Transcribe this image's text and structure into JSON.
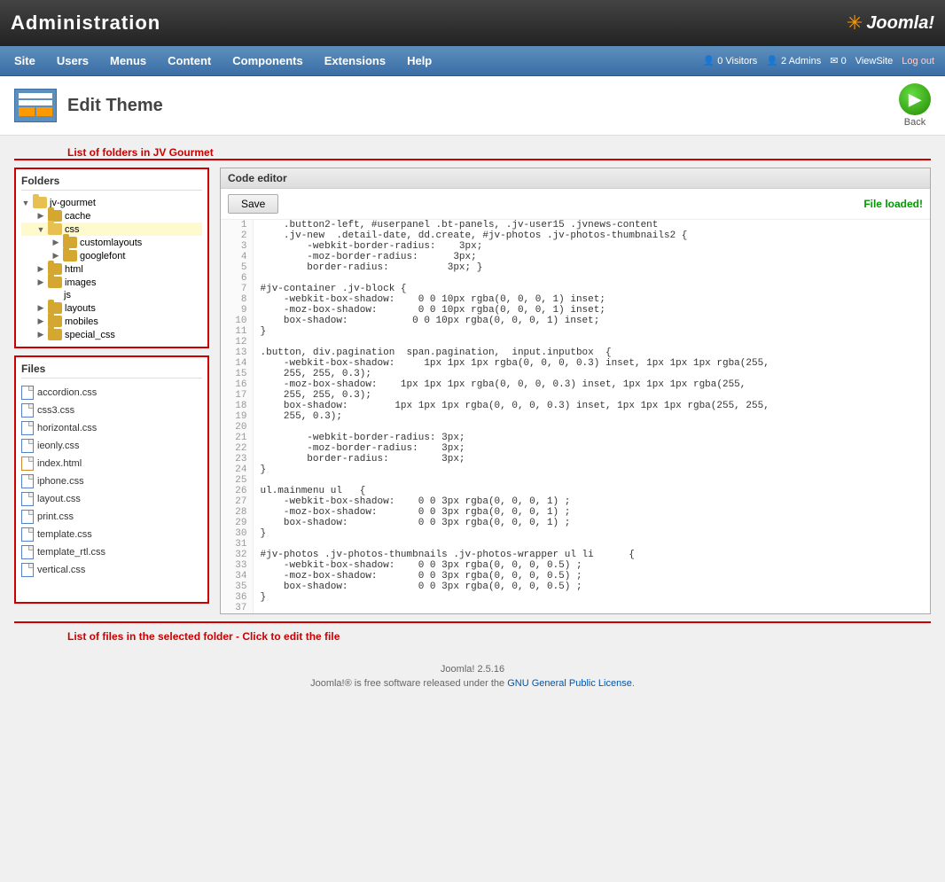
{
  "header": {
    "admin_title": "Administration",
    "joomla_logo": "Joomla!",
    "back_button_label": "Back"
  },
  "navbar": {
    "items": [
      {
        "label": "Site"
      },
      {
        "label": "Users"
      },
      {
        "label": "Menus"
      },
      {
        "label": "Content"
      },
      {
        "label": "Components"
      },
      {
        "label": "Extensions"
      },
      {
        "label": "Help"
      }
    ],
    "right": {
      "visitors": "0 Visitors",
      "admins": "2 Admins",
      "messages": "0",
      "view_site": "ViewSite",
      "log_out": "Log out"
    }
  },
  "page": {
    "title": "Edit Theme",
    "annotation_top": "List of folders in JV Gourmet",
    "annotation_bottom": "List of files in the selected folder - Click to edit the file"
  },
  "folders_panel": {
    "title": "Folders",
    "tree": [
      {
        "label": "jv-gourmet",
        "indent": 0,
        "expanded": true,
        "type": "folder"
      },
      {
        "label": "cache",
        "indent": 1,
        "expanded": false,
        "type": "folder"
      },
      {
        "label": "css",
        "indent": 1,
        "expanded": true,
        "type": "folder",
        "selected": true
      },
      {
        "label": "customlayouts",
        "indent": 2,
        "expanded": false,
        "type": "folder"
      },
      {
        "label": "googlefont",
        "indent": 2,
        "expanded": false,
        "type": "folder"
      },
      {
        "label": "html",
        "indent": 1,
        "expanded": false,
        "type": "folder"
      },
      {
        "label": "images",
        "indent": 1,
        "expanded": false,
        "type": "folder"
      },
      {
        "label": "js",
        "indent": 1,
        "expanded": false,
        "type": "folder-plain"
      },
      {
        "label": "layouts",
        "indent": 1,
        "expanded": false,
        "type": "folder"
      },
      {
        "label": "mobiles",
        "indent": 1,
        "expanded": false,
        "type": "folder"
      },
      {
        "label": "special_css",
        "indent": 1,
        "expanded": false,
        "type": "folder"
      }
    ]
  },
  "files_panel": {
    "title": "Files",
    "files": [
      {
        "label": "accordion.css",
        "type": "css"
      },
      {
        "label": "css3.css",
        "type": "css"
      },
      {
        "label": "horizontal.css",
        "type": "css"
      },
      {
        "label": "ieonly.css",
        "type": "css"
      },
      {
        "label": "index.html",
        "type": "html"
      },
      {
        "label": "iphone.css",
        "type": "css"
      },
      {
        "label": "layout.css",
        "type": "css"
      },
      {
        "label": "print.css",
        "type": "css"
      },
      {
        "label": "template.css",
        "type": "css"
      },
      {
        "label": "template_rtl.css",
        "type": "css"
      },
      {
        "label": "vertical.css",
        "type": "css"
      }
    ]
  },
  "code_editor": {
    "title": "Code editor",
    "save_label": "Save",
    "file_loaded_label": "File loaded!",
    "lines": [
      {
        "num": 1,
        "code": "    .button2-left, #userpanel .bt-panels, .jv-user15 .jvnews-content"
      },
      {
        "num": 2,
        "code": "    .jv-new  .detail-date, dd.create, #jv-photos .jv-photos-thumbnails2 {"
      },
      {
        "num": 3,
        "code": "        -webkit-border-radius:    3px;"
      },
      {
        "num": 4,
        "code": "        -moz-border-radius:      3px;"
      },
      {
        "num": 5,
        "code": "        border-radius:          3px; }"
      },
      {
        "num": 6,
        "code": ""
      },
      {
        "num": 7,
        "code": "#jv-container .jv-block {"
      },
      {
        "num": 8,
        "code": "    -webkit-box-shadow:    0 0 10px rgba(0, 0, 0, 1) inset;"
      },
      {
        "num": 9,
        "code": "    -moz-box-shadow:       0 0 10px rgba(0, 0, 0, 1) inset;"
      },
      {
        "num": 10,
        "code": "    box-shadow:           0 0 10px rgba(0, 0, 0, 1) inset;"
      },
      {
        "num": 11,
        "code": "}"
      },
      {
        "num": 12,
        "code": ""
      },
      {
        "num": 13,
        "code": ".button, div.pagination  span.pagination,  input.inputbox  {"
      },
      {
        "num": 14,
        "code": "    -webkit-box-shadow:     1px 1px 1px rgba(0, 0, 0, 0.3) inset, 1px 1px 1px rgba(255,"
      },
      {
        "num": 15,
        "code": "    255, 255, 0.3);"
      },
      {
        "num": 16,
        "code": "    -moz-box-shadow:    1px 1px 1px rgba(0, 0, 0, 0.3) inset, 1px 1px 1px rgba(255,"
      },
      {
        "num": 17,
        "code": "    255, 255, 0.3);"
      },
      {
        "num": 18,
        "code": "    box-shadow:        1px 1px 1px rgba(0, 0, 0, 0.3) inset, 1px 1px 1px rgba(255, 255,"
      },
      {
        "num": 19,
        "code": "    255, 0.3);"
      },
      {
        "num": 20,
        "code": ""
      },
      {
        "num": 21,
        "code": "        -webkit-border-radius: 3px;"
      },
      {
        "num": 22,
        "code": "        -moz-border-radius:    3px;"
      },
      {
        "num": 23,
        "code": "        border-radius:         3px;"
      },
      {
        "num": 24,
        "code": "}"
      },
      {
        "num": 25,
        "code": ""
      },
      {
        "num": 26,
        "code": "ul.mainmenu ul   {"
      },
      {
        "num": 27,
        "code": "    -webkit-box-shadow:    0 0 3px rgba(0, 0, 0, 1) ;"
      },
      {
        "num": 28,
        "code": "    -moz-box-shadow:       0 0 3px rgba(0, 0, 0, 1) ;"
      },
      {
        "num": 29,
        "code": "    box-shadow:            0 0 3px rgba(0, 0, 0, 1) ;"
      },
      {
        "num": 30,
        "code": "}"
      },
      {
        "num": 31,
        "code": ""
      },
      {
        "num": 32,
        "code": "#jv-photos .jv-photos-thumbnails .jv-photos-wrapper ul li      {"
      },
      {
        "num": 33,
        "code": "    -webkit-box-shadow:    0 0 3px rgba(0, 0, 0, 0.5) ;"
      },
      {
        "num": 34,
        "code": "    -moz-box-shadow:       0 0 3px rgba(0, 0, 0, 0.5) ;"
      },
      {
        "num": 35,
        "code": "    box-shadow:            0 0 3px rgba(0, 0, 0, 0.5) ;"
      },
      {
        "num": 36,
        "code": "}"
      },
      {
        "num": 37,
        "code": ""
      }
    ]
  },
  "footer": {
    "joomla_version": "Joomla! 2.5.16",
    "license_text": "Joomla!® is free software released under the ",
    "license_link": "GNU General Public License",
    "license_end": "."
  },
  "colors": {
    "accent_red": "#cc0000",
    "accent_green": "#009900",
    "nav_blue": "#3a6ea5",
    "folder_gold": "#d4a830"
  }
}
